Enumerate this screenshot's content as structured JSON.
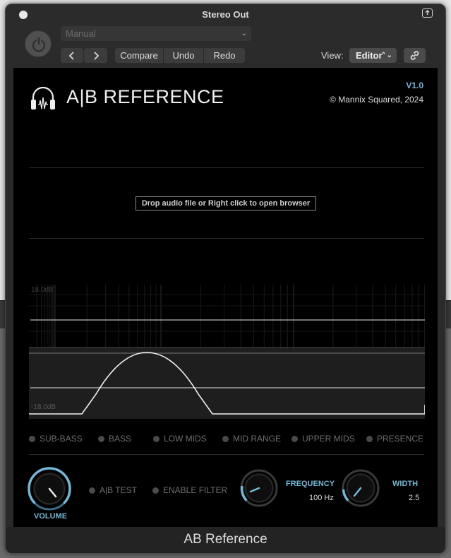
{
  "window": {
    "title": "Stereo Out"
  },
  "toolbar": {
    "preset": "Manual",
    "prev_icon": "chevron-left-icon",
    "next_icon": "chevron-right-icon",
    "compare_label": "Compare",
    "undo_label": "Undo",
    "redo_label": "Redo",
    "view_label": "View:",
    "view_value": "Editor"
  },
  "plugin": {
    "title": "A|B REFERENCE",
    "version": "V1.0",
    "copyright": "© Mannix Squared, 2024",
    "drop_hint": "Drop audio file or Right click to open browser",
    "eq": {
      "top_db_label": "18.0dB",
      "bottom_db_label": "-18.0dB"
    },
    "bands": [
      "SUB-BASS",
      "BASS",
      "LOW MIDS",
      "MID RANGE",
      "UPPER MIDS",
      "PRESENCE"
    ],
    "controls": {
      "volume_label": "VOLUME",
      "ab_test_label": "A|B TEST",
      "enable_filter_label": "ENABLE FILTER",
      "frequency_label": "FREQUENCY",
      "frequency_value": "100 Hz",
      "width_label": "WIDTH",
      "width_value": "2.5"
    }
  },
  "footer": {
    "name": "AB Reference"
  },
  "colors": {
    "accent": "#76b7d6",
    "background": "#000000",
    "chrome": "#2b2b2b"
  }
}
